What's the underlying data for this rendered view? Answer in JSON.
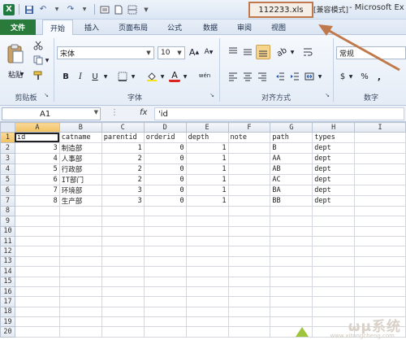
{
  "titlebar": {
    "filename": "112233.xls",
    "mode": "[兼容模式]",
    "app": "- Microsoft Ex"
  },
  "tabs": [
    {
      "label": "文件"
    },
    {
      "label": "开始"
    },
    {
      "label": "插入"
    },
    {
      "label": "页面布局"
    },
    {
      "label": "公式"
    },
    {
      "label": "数据"
    },
    {
      "label": "审阅"
    },
    {
      "label": "视图"
    }
  ],
  "ribbon": {
    "paste_label": "粘贴",
    "font_name": "宋体",
    "font_size": "10",
    "number_format": "常规",
    "groups": {
      "clipboard": "剪贴板",
      "font": "字体",
      "alignment": "对齐方式",
      "number": "数字"
    },
    "bold": "B",
    "italic": "I",
    "underline": "U",
    "wen": "wén",
    "percent": "%",
    "currency": "$",
    "comma": ","
  },
  "formula_bar": {
    "cell_ref": "A1",
    "fx": "fx",
    "content": "'id"
  },
  "columns": [
    "A",
    "B",
    "C",
    "D",
    "E",
    "F",
    "G",
    "H",
    "I"
  ],
  "rows": [
    [
      "id",
      "catname",
      "parentid",
      "orderid",
      "depth",
      "note",
      "path",
      "types",
      ""
    ],
    [
      "3",
      "制造部",
      "1",
      "0",
      "1",
      "",
      "B",
      "dept",
      ""
    ],
    [
      "4",
      "人事部",
      "2",
      "0",
      "1",
      "",
      "AA",
      "dept",
      ""
    ],
    [
      "5",
      "行政部",
      "2",
      "0",
      "1",
      "",
      "AB",
      "dept",
      ""
    ],
    [
      "6",
      "IT部门",
      "2",
      "0",
      "1",
      "",
      "AC",
      "dept",
      ""
    ],
    [
      "7",
      "环境部",
      "3",
      "0",
      "1",
      "",
      "BA",
      "dept",
      ""
    ],
    [
      "8",
      "生产部",
      "3",
      "0",
      "1",
      "",
      "BB",
      "dept",
      ""
    ]
  ],
  "row_numbers": [
    "1",
    "2",
    "3",
    "4",
    "5",
    "6",
    "7",
    "8",
    "9",
    "10",
    "11",
    "12",
    "13",
    "14",
    "15",
    "16",
    "17",
    "18",
    "19",
    "20"
  ],
  "colors": {
    "file_tab": "#2a7a3c",
    "annotation": "#c0794a",
    "selected_header": "#f1c15f"
  }
}
